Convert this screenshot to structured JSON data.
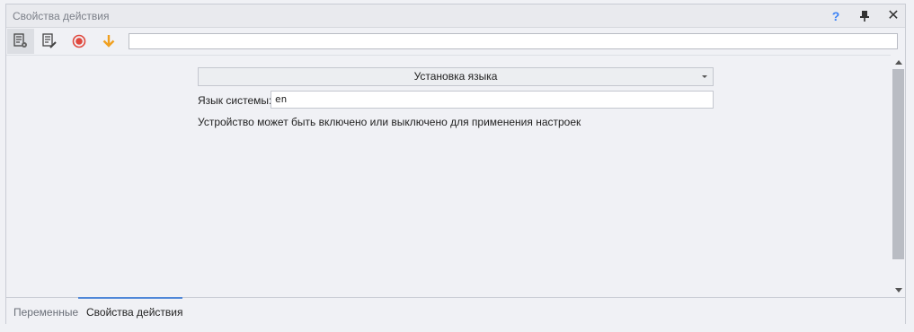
{
  "window": {
    "title": "Свойства действия"
  },
  "titlebar_buttons": {
    "help_icon": "question-mark",
    "pin_icon": "pin",
    "close_icon": "close-x"
  },
  "toolbar": {
    "tools": [
      {
        "icon": "properties-document-gear-icon",
        "active": true
      },
      {
        "icon": "edit-document-icon",
        "active": false
      },
      {
        "icon": "record-circle-icon",
        "color": "#e0483d",
        "active": false
      },
      {
        "icon": "arrow-down-icon",
        "color": "#f0a020",
        "active": false
      }
    ],
    "path_value": ""
  },
  "main": {
    "section_title": "Установка языка",
    "language_label": "Язык системы:",
    "language_value": "en",
    "hint": "Устройство может быть включено или выключено для применения настроек"
  },
  "tabs": [
    {
      "label": "Переменные",
      "active": false
    },
    {
      "label": "Свойства действия",
      "active": true
    }
  ],
  "colors": {
    "accent": "#4f87d8",
    "help": "#3b82f6",
    "record": "#e0483d",
    "download": "#f0a020"
  }
}
